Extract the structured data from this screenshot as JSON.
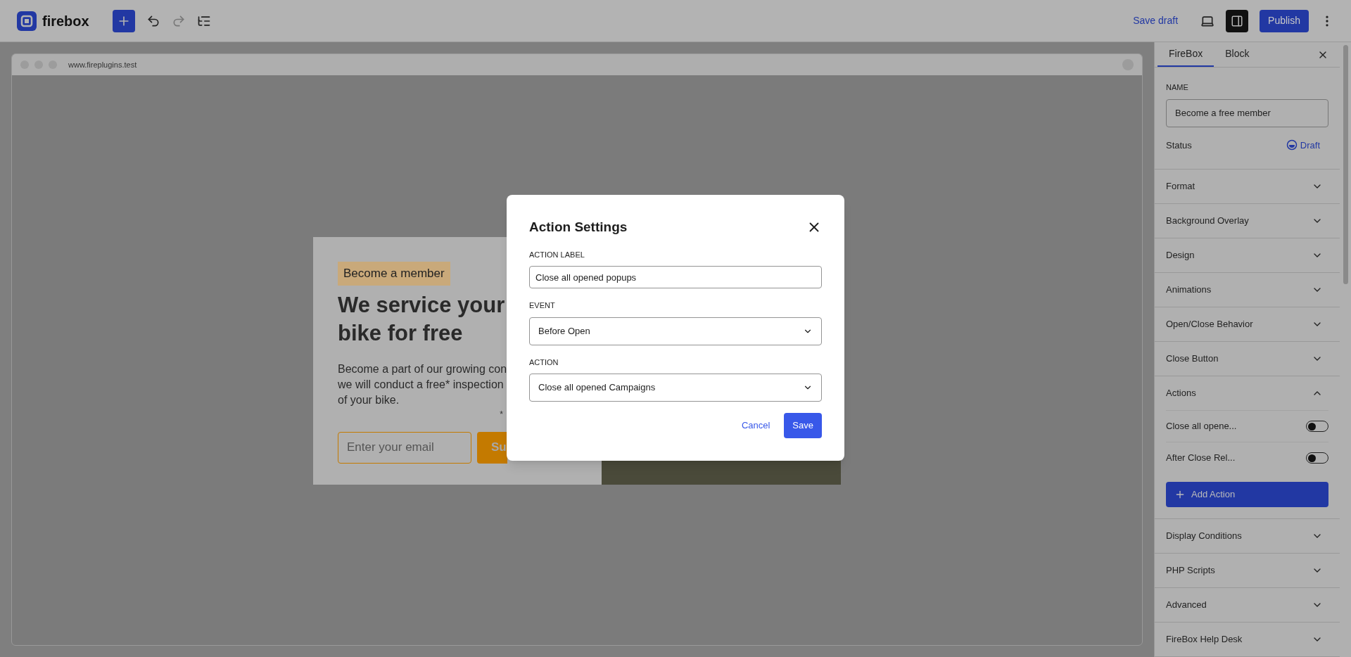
{
  "topbar": {
    "logo_text": "firebox",
    "save_draft": "Save draft",
    "publish": "Publish"
  },
  "canvas": {
    "url": "www.fireplugins.test",
    "popup": {
      "badge": "Become a member",
      "heading": "We service your bike for free",
      "body_lines": [
        "Become a part of our growing con",
        "we will conduct a free* inspection",
        "of your bike."
      ],
      "footnote": "*",
      "email_placeholder": "Enter your email",
      "submit": "Su"
    }
  },
  "modal": {
    "title": "Action Settings",
    "fields": [
      {
        "label": "ACTION LABEL",
        "kind": "text",
        "value": "Close all opened popups"
      },
      {
        "label": "EVENT",
        "kind": "select",
        "value": "Before Open"
      },
      {
        "label": "ACTION",
        "kind": "select",
        "value": "Close all opened Campaigns"
      }
    ],
    "cancel": "Cancel",
    "save": "Save"
  },
  "sidebar": {
    "tabs": [
      {
        "label": "FireBox",
        "selected": true
      },
      {
        "label": "Block",
        "selected": false
      }
    ],
    "name_label": "NAME",
    "name_value": "Become a free member",
    "status_label": "Status",
    "status_value": "Draft",
    "sections": [
      {
        "title": "Format",
        "expanded": false
      },
      {
        "title": "Background Overlay",
        "expanded": false
      },
      {
        "title": "Design",
        "expanded": false
      },
      {
        "title": "Animations",
        "expanded": false
      },
      {
        "title": "Open/Close Behavior",
        "expanded": false
      },
      {
        "title": "Close Button",
        "expanded": false
      },
      {
        "title": "Actions",
        "expanded": true,
        "items": [
          {
            "label": "Close all opene...",
            "on": false
          },
          {
            "label": "After Close Rel...",
            "on": false
          }
        ],
        "add_label": "Add Action"
      },
      {
        "title": "Display Conditions",
        "expanded": false
      },
      {
        "title": "PHP Scripts",
        "expanded": false
      },
      {
        "title": "Advanced",
        "expanded": false
      },
      {
        "title": "FireBox Help Desk",
        "expanded": false
      }
    ]
  }
}
